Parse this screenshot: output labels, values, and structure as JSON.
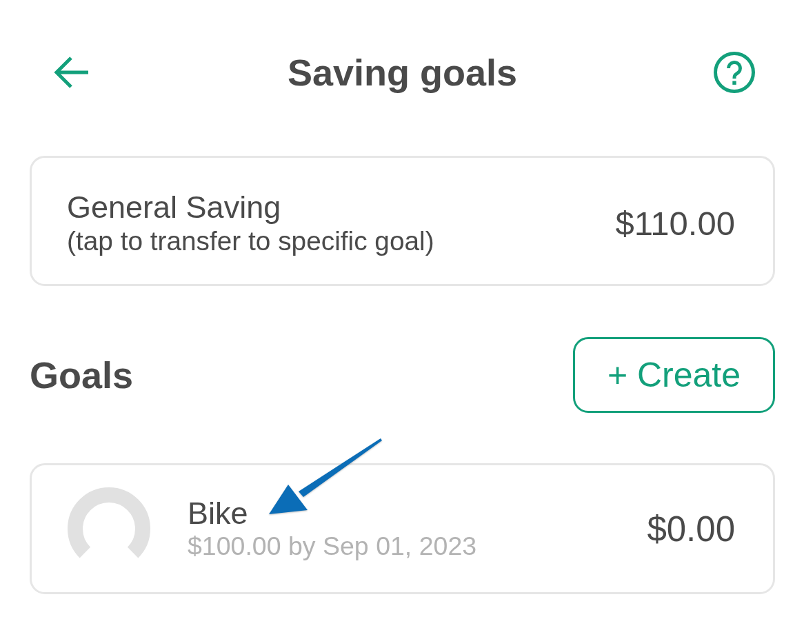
{
  "header": {
    "title": "Saving goals"
  },
  "general_saving": {
    "title": "General Saving",
    "subtitle": "(tap to transfer to specific goal)",
    "amount": "$110.00"
  },
  "goals_section": {
    "heading": "Goals",
    "create_button": {
      "label": "+ Create"
    }
  },
  "goals": [
    {
      "name": "Bike",
      "target": "$100.00 by Sep 01, 2023",
      "amount": "$0.00",
      "pointer_arrow": true
    }
  ]
}
